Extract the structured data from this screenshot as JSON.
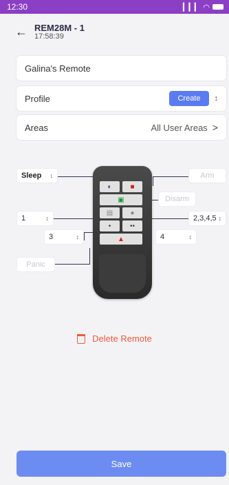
{
  "status_bar": {
    "time": "12:30",
    "signal": "▎▎▎",
    "wifi": "◠"
  },
  "header": {
    "back_icon": "←",
    "title": "REM28M - 1",
    "subtitle": "17:58:39"
  },
  "name_field": {
    "value": "Galina's Remote"
  },
  "profile": {
    "label": "Profile",
    "create_label": "Create",
    "updown_icon": "↕"
  },
  "areas": {
    "label": "Areas",
    "value": "All User Areas",
    "chevron": ">"
  },
  "remote_config": {
    "sleep": "Sleep",
    "arm": "Arm",
    "disarm": "Disarm",
    "left_top": "1",
    "right_top": "2,3,4,5",
    "left_bottom": "3",
    "right_bottom": "4",
    "panic": "Panic",
    "caret": "↕"
  },
  "delete": {
    "label": "Delete Remote"
  },
  "save": {
    "label": "Save"
  },
  "colors": {
    "status_bar": "#8b3fc5",
    "accent": "#5a7cf0",
    "danger": "#f05a3c"
  }
}
